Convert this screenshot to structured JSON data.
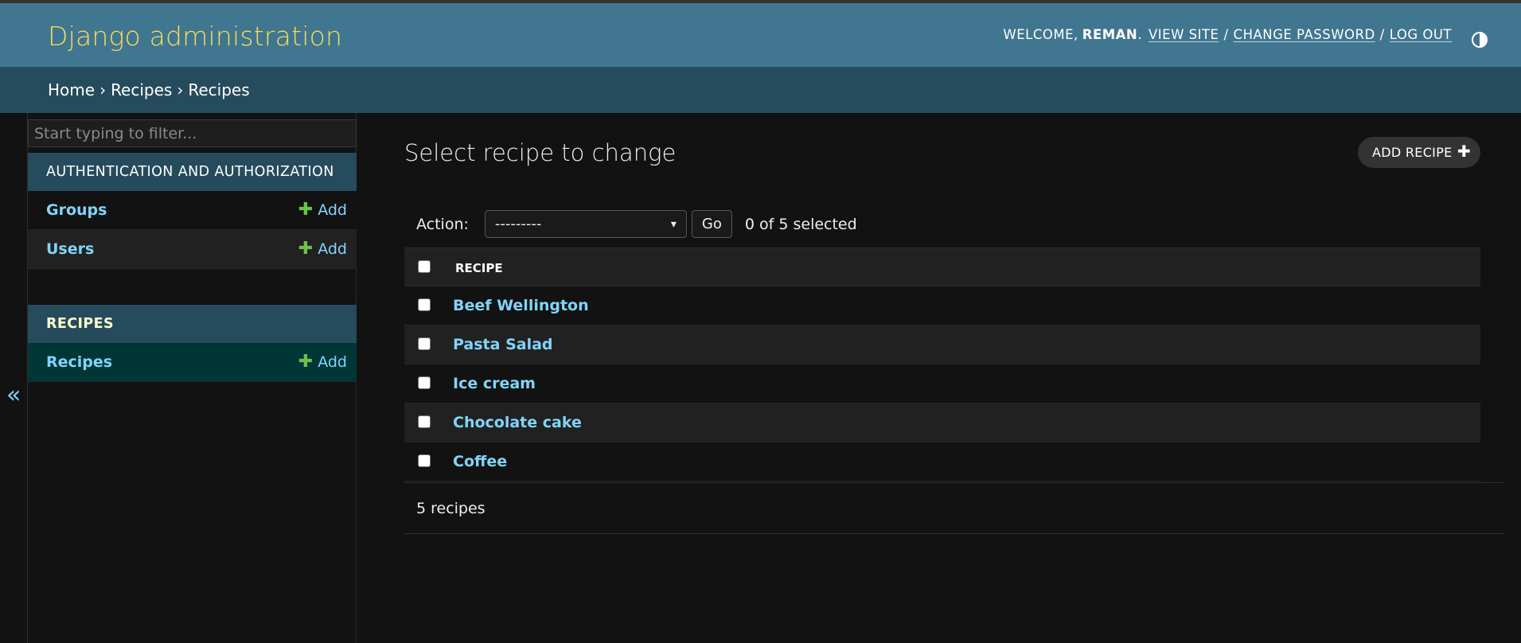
{
  "header": {
    "brand": "Django administration",
    "welcome": "WELCOME,",
    "username": "REMAN",
    "links": [
      "VIEW SITE",
      "CHANGE PASSWORD",
      "LOG OUT"
    ],
    "theme_icon": "half-circle-contrast-icon"
  },
  "breadcrumbs": {
    "home": "Home",
    "app": "Recipes",
    "current": "Recipes",
    "separator": "›"
  },
  "sidebar": {
    "filter_placeholder": "Start typing to filter...",
    "collapse_toggle": "«",
    "modules": [
      {
        "caption": "Authentication and Authorization",
        "models": [
          {
            "name": "Groups",
            "add": "Add"
          },
          {
            "name": "Users",
            "add": "Add"
          }
        ]
      },
      {
        "caption": "Recipes",
        "models": [
          {
            "name": "Recipes",
            "add": "Add"
          }
        ]
      }
    ]
  },
  "content": {
    "title": "Select recipe to change",
    "add_button": "ADD RECIPE",
    "actions": {
      "label": "Action:",
      "selected": "---------",
      "go": "Go",
      "counter": "0 of 5 selected"
    },
    "table": {
      "header": "RECIPE",
      "rows": [
        "Beef Wellington",
        "Pasta Salad",
        "Ice cream",
        "Chocolate cake",
        "Coffee"
      ]
    },
    "paginator": "5 recipes"
  },
  "colors": {
    "header_bg": "#417690",
    "brand": "#f5dd5d",
    "breadcrumbs_bg": "#264b5d",
    "link": "#81d4fa",
    "add_plus": "#6cc24a",
    "current_model_bg": "#003636",
    "page_bg": "#121212"
  }
}
